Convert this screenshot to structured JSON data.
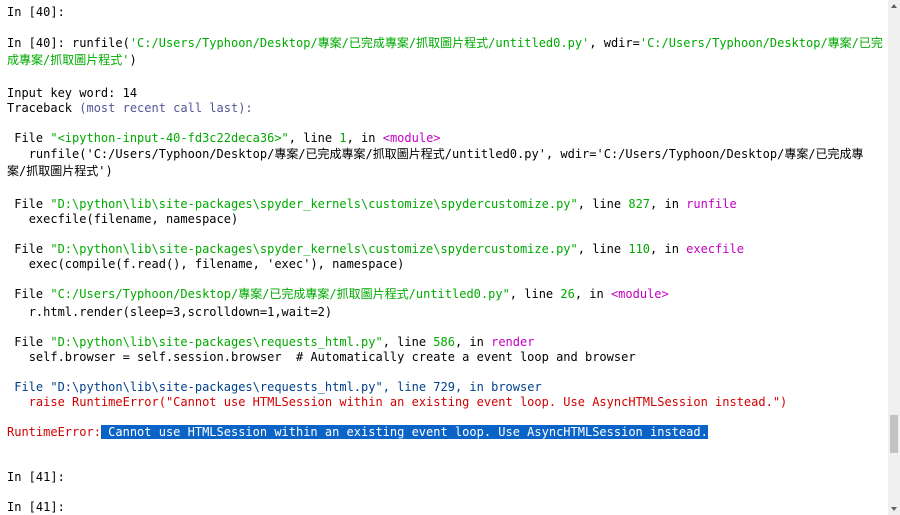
{
  "console": {
    "prompt1": "In [40]:",
    "run_prompt": "In [40]:",
    "run_cmd": " runfile(",
    "run_arg1": "'C:/Users/Typhoon/Desktop/專案/已完成專案/抓取圖片程式/untitled0.py'",
    "run_mid": ", wdir=",
    "run_arg2a": "'C:/Users/Typhoon/Desktop/專案/已完",
    "run_arg2b": "成專案/抓取圖片程式'",
    "run_close": ")",
    "input_line": "Input key word: 14",
    "tb_label": "Traceback ",
    "tb_paren": "(most recent call last):",
    "frames": [
      {
        "file_kw": "File ",
        "file": "\"<ipython-input-40-fd3c22deca36>\"",
        "line_kw": ", line ",
        "line": "1",
        "in_kw": ", in ",
        "func": "<module>",
        "code1": "runfile('C:/Users/Typhoon/Desktop/專案/已完成專案/抓取圖片程式/untitled0.py', wdir='C:/Users/Typhoon/Desktop/專案/已完成專",
        "code2": "案/抓取圖片程式')"
      },
      {
        "file_kw": "File ",
        "file": "\"D:\\python\\lib\\site-packages\\spyder_kernels\\customize\\spydercustomize.py\"",
        "line_kw": ", line ",
        "line": "827",
        "in_kw": ", in ",
        "func": "runfile",
        "code1": "execfile(filename, namespace)"
      },
      {
        "file_kw": "File ",
        "file": "\"D:\\python\\lib\\site-packages\\spyder_kernels\\customize\\spydercustomize.py\"",
        "line_kw": ", line ",
        "line": "110",
        "in_kw": ", in ",
        "func": "execfile",
        "code1": "exec(compile(f.read(), filename, 'exec'), namespace)"
      },
      {
        "file_kw": "File ",
        "file": "\"C:/Users/Typhoon/Desktop/專案/已完成專案/抓取圖片程式/untitled0.py\"",
        "line_kw": ", line ",
        "line": "26",
        "in_kw": ", in ",
        "func": "<module>",
        "code1": "r.html.render(sleep=3,scrolldown=1,wait=2)"
      },
      {
        "file_kw": "File ",
        "file": "\"D:\\python\\lib\\site-packages\\requests_html.py\"",
        "line_kw": ", line ",
        "line": "586",
        "in_kw": ", in ",
        "func": "render",
        "code1": "self.browser = self.session.browser  # Automatically create a event loop and browser"
      },
      {
        "file_kw": "File ",
        "file": "\"D:\\python\\lib\\site-packages\\requests_html.py\"",
        "line_kw": ", line ",
        "line": "729",
        "in_kw": ", in ",
        "func": "browser",
        "code1": "raise RuntimeError(\"Cannot use HTMLSession within an existing event loop. Use AsyncHTMLSession instead.\")"
      }
    ],
    "error_type": "RuntimeError:",
    "error_msg": " Cannot use HTMLSession within an existing event loop. Use AsyncHTMLSession instead.",
    "prompt2": "In [41]:",
    "prompt3": "In [41]:"
  },
  "colors": {
    "string": "#00aa00",
    "func_name": "#c400c4",
    "error": "#d40000",
    "selection": "#0a64c8",
    "last_frame": "#00408a"
  },
  "scrollbar": {
    "position_fraction": 0.82
  }
}
